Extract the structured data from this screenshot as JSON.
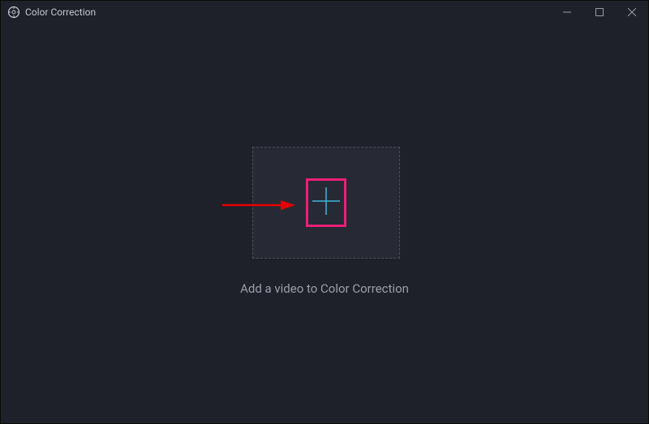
{
  "window": {
    "title": "Color Correction"
  },
  "main": {
    "hint": "Add a video to Color Correction"
  },
  "colors": {
    "accent_plus": "#3fb4dd",
    "highlight_box": "#ed1e79",
    "arrow": "#e60000"
  }
}
